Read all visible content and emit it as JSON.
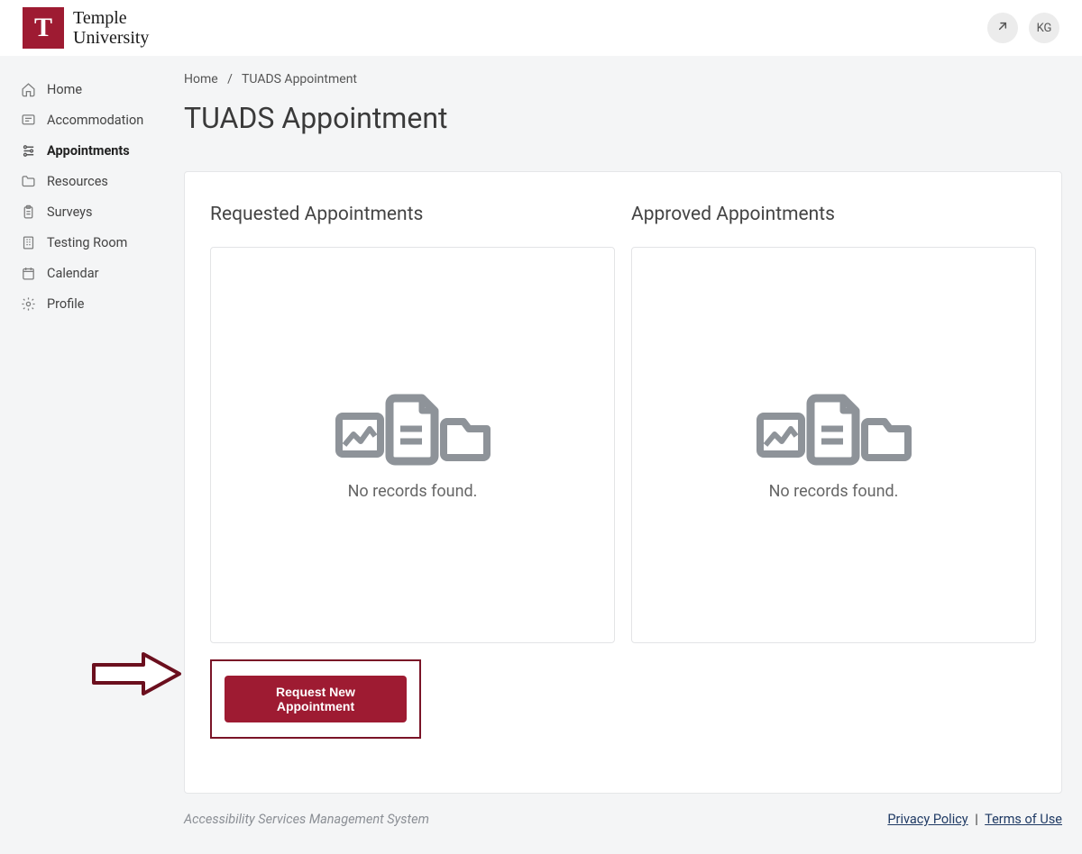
{
  "brand": {
    "logo_letter": "T",
    "name_line1": "Temple",
    "name_line2": "University"
  },
  "header": {
    "user_initials": "KG"
  },
  "sidebar": {
    "items": [
      {
        "label": "Home"
      },
      {
        "label": "Accommodation"
      },
      {
        "label": "Appointments"
      },
      {
        "label": "Resources"
      },
      {
        "label": "Surveys"
      },
      {
        "label": "Testing Room"
      },
      {
        "label": "Calendar"
      },
      {
        "label": "Profile"
      }
    ]
  },
  "breadcrumb": {
    "home": "Home",
    "sep": "/",
    "current": "TUADS Appointment"
  },
  "page_title": "TUADS Appointment",
  "sections": {
    "requested": {
      "title": "Requested Appointments",
      "empty": "No records found."
    },
    "approved": {
      "title": "Approved Appointments",
      "empty": "No records found."
    }
  },
  "buttons": {
    "request_new": "Request New Appointment"
  },
  "footer": {
    "system": "Accessibility Services Management System",
    "privacy": "Privacy Policy",
    "terms": "Terms of Use"
  }
}
